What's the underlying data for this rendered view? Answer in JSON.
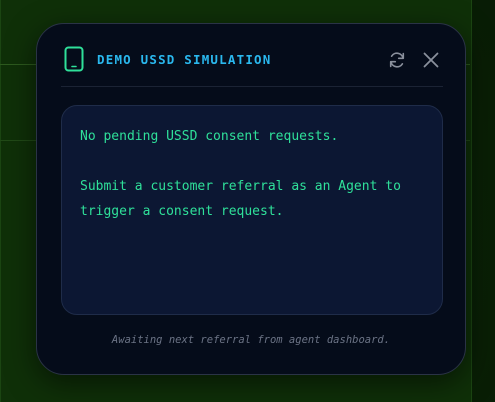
{
  "background": {
    "color": "#0a2206"
  },
  "modal": {
    "title": "DEMO USSD SIMULATION",
    "icon": "phone-icon",
    "accent_color": "#2ab8ee",
    "actions": {
      "refresh_icon": "refresh-icon",
      "close_icon": "close-icon"
    }
  },
  "screen": {
    "text_color": "#2fe09a",
    "lines": [
      "No pending USSD consent requests.",
      "Submit a customer referral as an Agent to trigger a consent request."
    ]
  },
  "footer": {
    "status": "Awaiting next referral from agent dashboard."
  }
}
